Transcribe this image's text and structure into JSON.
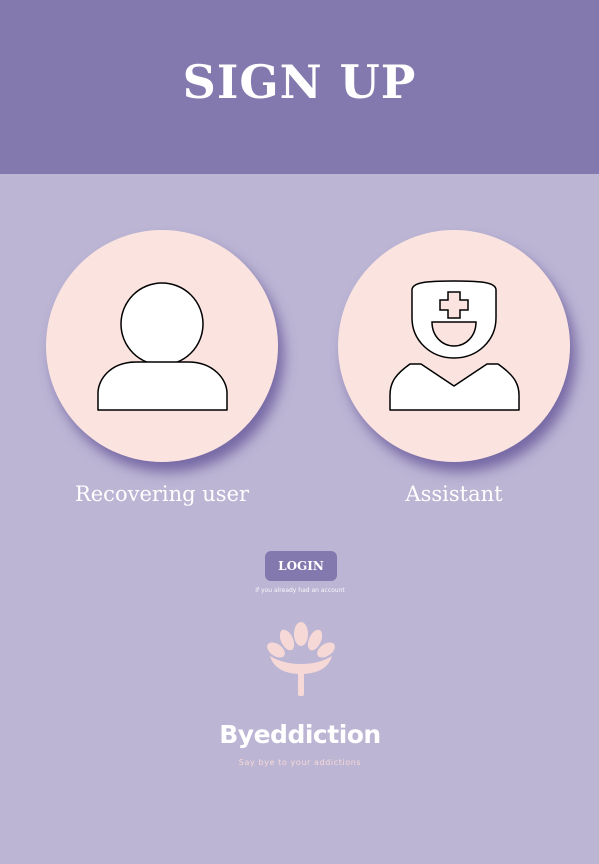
{
  "header": {
    "title": "SIGN UP"
  },
  "roles": [
    {
      "label": "Recovering user",
      "icon": "user-icon"
    },
    {
      "label": "Assistant",
      "icon": "nurse-icon"
    }
  ],
  "login": {
    "button_label": "LOGIN",
    "hint": "If you already had an account"
  },
  "brand": {
    "logo_icon": "lotus-icon",
    "name": "Byeddiction",
    "tagline": "Say bye to your addictions"
  },
  "colors": {
    "header_bg": "#8479ae",
    "page_bg": "#bcb5d4",
    "card_bg": "#fbe4e0",
    "accent_pink": "#f6d9d6",
    "text": "#ffffff"
  }
}
